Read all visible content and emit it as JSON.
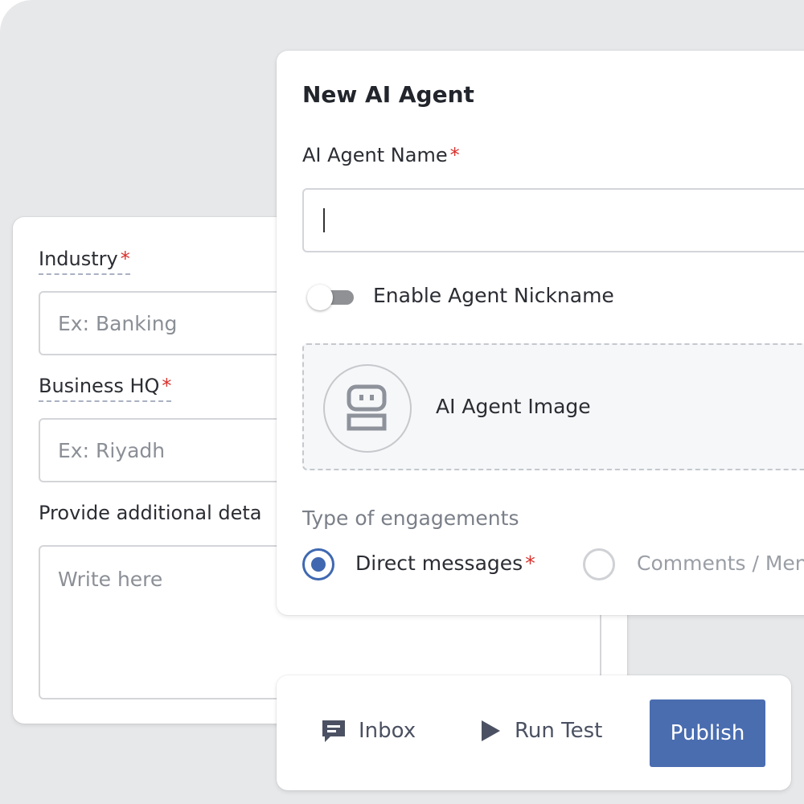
{
  "business_form": {
    "industry_label": "Industry",
    "industry_placeholder": "Ex: Banking",
    "hq_label": "Business HQ",
    "hq_placeholder": "Ex: Riyadh",
    "details_label": "Provide additional deta",
    "details_placeholder": "Write here",
    "required_mark": "*"
  },
  "agent_form": {
    "title": "New AI Agent",
    "name_label": "AI Agent Name",
    "name_value": "",
    "nickname_toggle_label": "Enable Agent Nickname",
    "nickname_enabled": false,
    "image_label": "AI Agent Image",
    "engagement_label": "Type of engagements",
    "engagement_options": [
      {
        "label": "Direct messages",
        "selected": true,
        "required": true
      },
      {
        "label": "Comments / Men",
        "selected": false,
        "required": false
      }
    ]
  },
  "actions": {
    "inbox_label": "Inbox",
    "run_test_label": "Run Test",
    "publish_label": "Publish"
  },
  "icons": {
    "inbox": "chat-bubble-icon",
    "run_test": "play-icon",
    "agent_image": "robot-icon"
  },
  "colors": {
    "accent": "#4a6db0",
    "required": "#d9302c",
    "background": "#e7e8ea"
  }
}
